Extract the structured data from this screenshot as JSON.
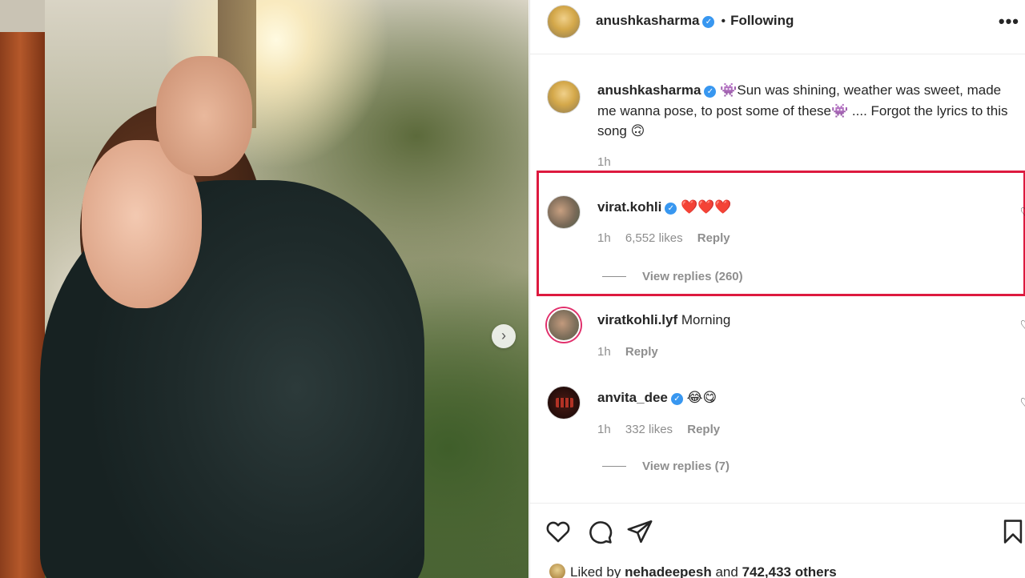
{
  "post": {
    "author": "anushkasharma",
    "following_label": "Following",
    "more_label": "•••",
    "caption_pre": "👾",
    "caption": "Sun was shining, weather was sweet, made me wanna pose, to post some of these👾 .... Forgot the lyrics to this song 🙃",
    "caption_time": "1h"
  },
  "comments": [
    {
      "user": "virat.kohli",
      "verified": true,
      "text": "❤️❤️❤️",
      "time": "1h",
      "likes": "6,552 likes",
      "reply_label": "Reply",
      "view_replies": "View replies (260)"
    },
    {
      "user": "viratkohli.lyf",
      "verified": false,
      "text": "Morning",
      "time": "1h",
      "reply_label": "Reply"
    },
    {
      "user": "anvita_dee",
      "verified": true,
      "text": "😂😋",
      "time": "1h",
      "likes": "332 likes",
      "reply_label": "Reply",
      "view_replies": "View replies (7)"
    }
  ],
  "footer": {
    "liked_by_prefix": "Liked by",
    "liked_by_user": "nehadeepesh",
    "liked_by_and": "and",
    "liked_by_others": "742,433 others"
  },
  "icons": {
    "verified": "verified-badge-icon",
    "like": "heart-icon",
    "comment": "comment-icon",
    "share": "share-icon",
    "save": "bookmark-icon",
    "next": "chevron-right-icon"
  },
  "colors": {
    "highlight_box": "#dd1a3f",
    "verified": "#3897f0",
    "meta_text": "#8e8e8e"
  }
}
